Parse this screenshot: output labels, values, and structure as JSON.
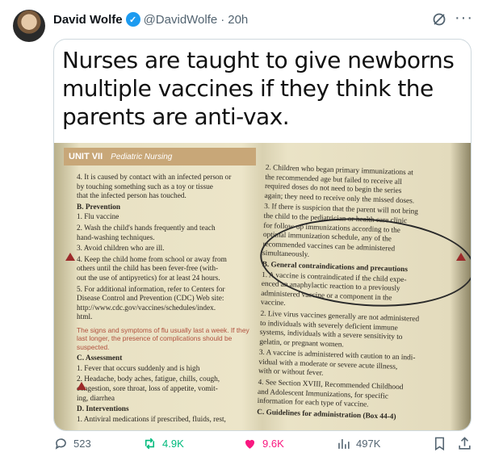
{
  "post": {
    "author_name": "David Wolfe",
    "handle": "@DavidWolfe",
    "separator": "·",
    "time": "20h",
    "verified_mark": "✓",
    "more_label": "···"
  },
  "media": {
    "headline": "Nurses are taught to give newborns multiple vaccines if they think the parents are anti-vax.",
    "book": {
      "unit_label": "UNIT VII",
      "unit_section": "Pediatric Nursing",
      "left_column": [
        {
          "t": "item",
          "text": "4.  It is caused by contact with an infected person or\n    by touching something such as a toy or tissue\n    that the infected person has touched."
        },
        {
          "t": "head",
          "text": "B.  Prevention"
        },
        {
          "t": "item",
          "text": "1.  Flu vaccine"
        },
        {
          "t": "item",
          "text": "2.  Wash the child's hands frequently and teach\n    hand-washing techniques."
        },
        {
          "t": "item",
          "text": "3.  Avoid children who are ill."
        },
        {
          "t": "item",
          "text": "4.  Keep the child home from school or away from\n    others until the child has been fever-free (with-\n    out the use of antipyretics) for at least 24 hours."
        },
        {
          "t": "item",
          "text": "5.  For additional information, refer to Centers for\n    Disease Control and Prevention (CDC) Web site:\n    http://www.cdc.gov/vaccines/schedules/index.\n    html."
        },
        {
          "t": "warn",
          "text": "The signs and symptoms of flu usually last a week.\nIf they last longer, the presence of complications should\nbe suspected."
        },
        {
          "t": "head",
          "text": "C.  Assessment"
        },
        {
          "t": "item",
          "text": "1.  Fever that occurs suddenly and is high"
        },
        {
          "t": "item",
          "text": "2.  Headache, body aches, fatigue, chills, cough,\n    congestion, sore throat, loss of appetite, vomit-\n    ing, diarrhea"
        },
        {
          "t": "head",
          "text": "D.  Interventions"
        },
        {
          "t": "item",
          "text": "1.  Antiviral medications if prescribed, fluids, rest,"
        }
      ],
      "right_column": [
        {
          "t": "item",
          "text": "2.  Children who began primary immunizations at\n    the recommended age but failed to receive all\n    required doses do not need to begin the series\n    again; they need to receive only the missed doses."
        },
        {
          "t": "item",
          "text": "3.  If there is suspicion that the parent will not bring\n    the child to the pediatrician or health care clinic\n    for follow-up immunizations according to the\n    optimal immunization schedule, any of the\n    recommended vaccines can be administered\n    simultaneously."
        },
        {
          "t": "head",
          "text": "B.  General contraindications and precautions"
        },
        {
          "t": "item",
          "text": "1.  A vaccine is contraindicated if the child expe-\n    enced an anaphylactic reaction to a previously\n    administered vaccine or a component in the\n    vaccine."
        },
        {
          "t": "item",
          "text": "2.  Live virus vaccines generally are not administered\n    to individuals with severely deficient immune\n    systems, individuals with a severe sensitivity to\n    gelatin, or pregnant women."
        },
        {
          "t": "item",
          "text": "3.  A vaccine is administered with caution to an indi-\n    vidual with a moderate or severe acute illness,\n    with or without fever."
        },
        {
          "t": "item",
          "text": "4.  See Section XVIII, Recommended Childhood\n    and Adolescent Immunizations, for specific\n    information for each type of vaccine."
        },
        {
          "t": "head",
          "text": "C.  Guidelines for administration (Box 44-4)"
        }
      ]
    }
  },
  "actions": {
    "replies": "523",
    "reposts": "4.9K",
    "likes": "9.6K",
    "views": "497K"
  },
  "icons": {
    "reply": "reply-icon",
    "repost": "repost-icon",
    "like": "heart-icon",
    "views": "views-icon",
    "bookmark": "bookmark-icon",
    "share": "share-icon",
    "grok": "grok-icon",
    "more": "more-icon"
  },
  "colors": {
    "verified": "#1d9bf0",
    "repost_active": "#00ba7c",
    "like_active": "#f91880",
    "muted": "#536471",
    "book_accent": "#c8a778"
  }
}
